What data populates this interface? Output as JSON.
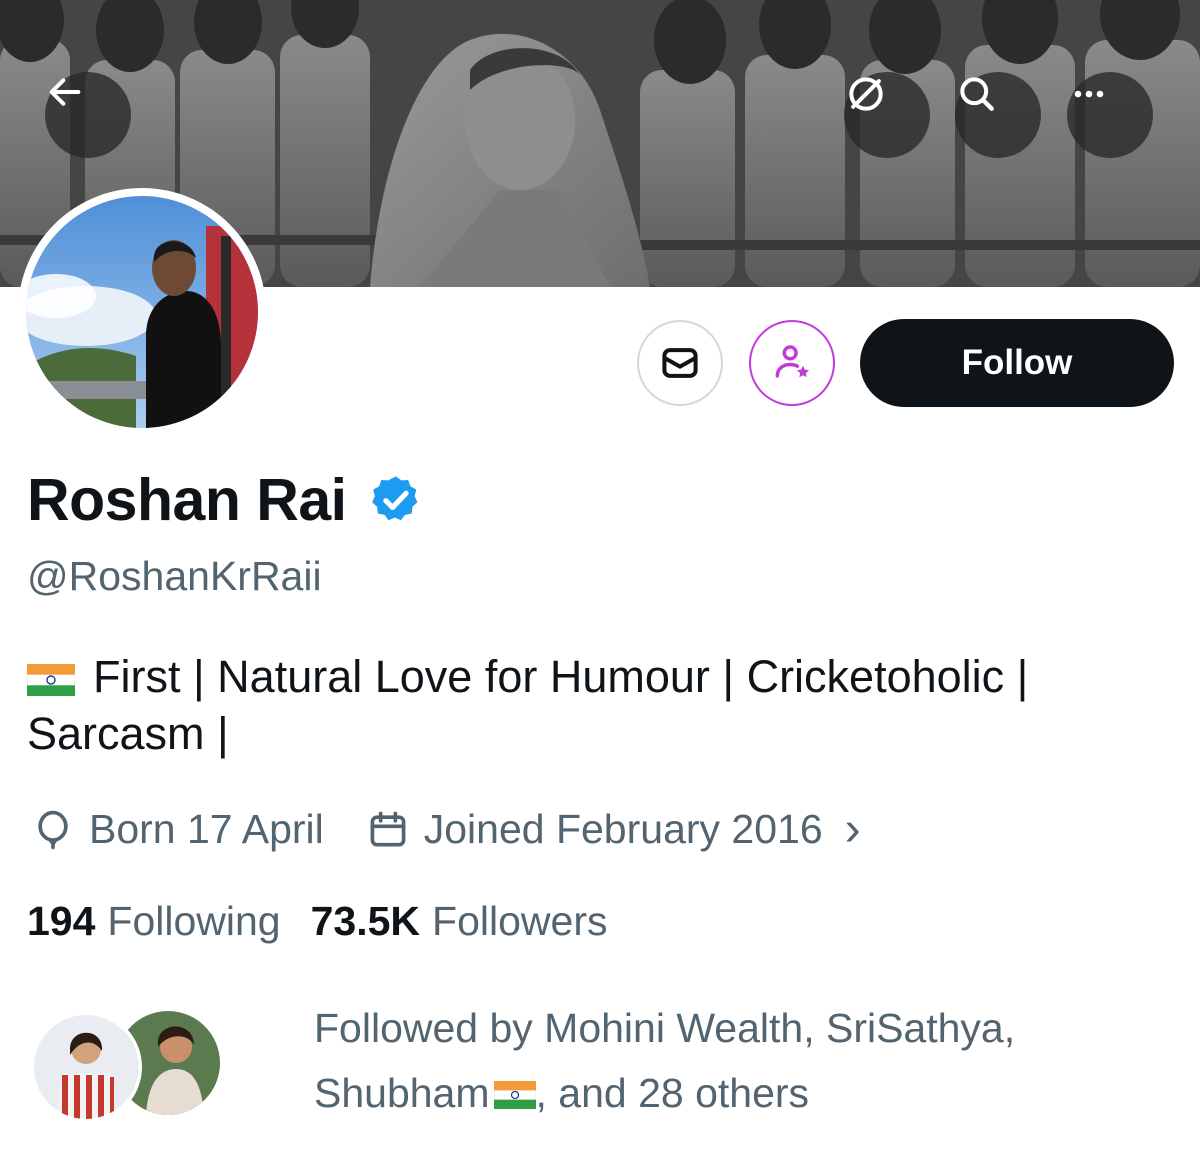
{
  "banner": {
    "back_icon": "arrow-left-icon",
    "translate_icon": "slashed-circle-icon",
    "search_icon": "search-icon",
    "more_icon": "more-horizontal-icon"
  },
  "profile": {
    "display_name": "Roshan Rai",
    "verified": true,
    "handle": "@RoshanKrRaii",
    "bio_flag": "india-flag-icon",
    "bio_text": "First | Natural Love for Humour | Cricketoholic | Sarcasm |",
    "birthday": "Born 17 April",
    "joined": "Joined February 2016",
    "joined_chevron": "›",
    "following_count": "194",
    "following_label": "Following",
    "followers_count": "73.5K",
    "followers_label": "Followers",
    "followed_by_prefix": "Followed by Mohini Wealth, SriSathya, Shubham",
    "followed_by_suffix": ", and 28 others"
  },
  "actions": {
    "message_icon": "envelope-icon",
    "subscribe_icon": "person-star-icon",
    "follow_label": "Follow"
  },
  "colors": {
    "accent_verified": "#1d9bf0",
    "subscribe_purple": "#c13bd9",
    "text_primary": "#0f1419",
    "text_secondary": "#536471"
  }
}
